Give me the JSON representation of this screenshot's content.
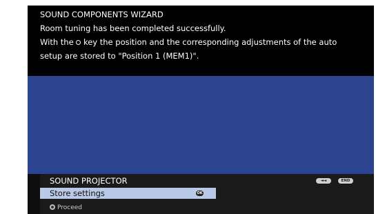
{
  "info": {
    "title": "SOUND COMPONENTS WIZARD",
    "line1": "Room tuning has been completed successfully.",
    "line2_before_key": "With the ",
    "line2_after_key": " key the position and the corresponding adjustments of the auto",
    "line3": "setup are stored to \"Position 1 (MEM1)\"."
  },
  "menu": {
    "title": "SOUND PROJECTOR",
    "items": [
      {
        "label": "Store settings",
        "badge": "OK",
        "selected": true
      }
    ],
    "hint": "Proceed"
  },
  "nav_buttons": {
    "back": "◄◄",
    "end": "END"
  },
  "colors": {
    "info_background": "#000000",
    "content_background": "#2c4490",
    "menu_background": "#1a1a1a",
    "selected_item": "#b9c9e6"
  },
  "icons": {
    "key": "ok-key-icon",
    "hint": "ok-button-icon"
  }
}
